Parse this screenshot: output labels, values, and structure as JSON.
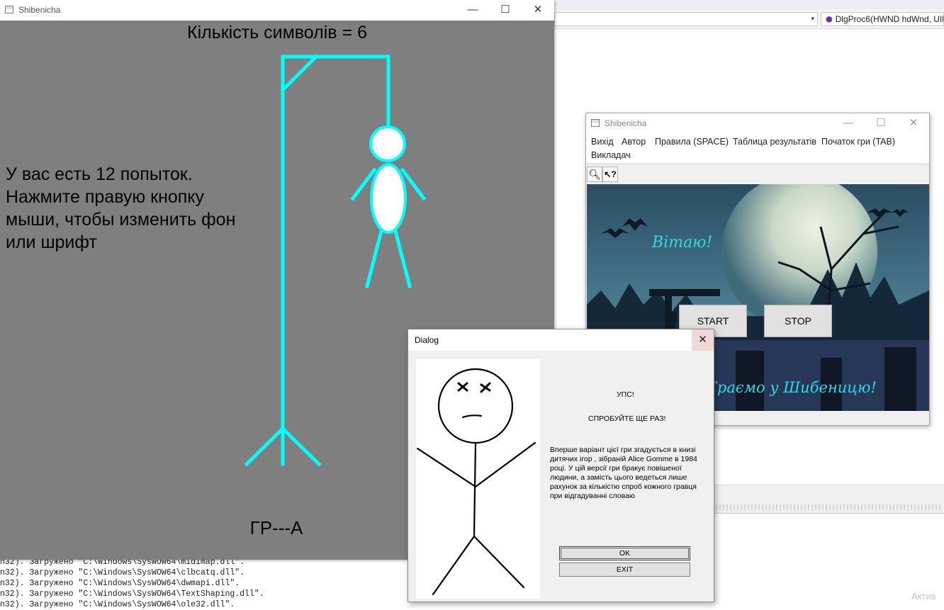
{
  "ide": {
    "function_combo": "DlgProc6(HWND hdWnd, UIN",
    "output_lines": [
      "n32). Загружено \"C:\\Windows\\SysWOW64\\midimap.dll\".",
      "n32). Загружено \"C:\\Windows\\SysWOW64\\clbcatq.dll\".",
      "n32). Загружено \"C:\\Windows\\SysWOW64\\dwmapi.dll\".",
      "n32). Загружено \"C:\\Windows\\SysWOW64\\TextShaping.dll\".",
      "n32). Загружено \"C:\\Windows\\SysWOW64\\ole32.dll\"."
    ],
    "watermark": "Актив"
  },
  "game_window": {
    "title": "Shibenicha",
    "symbol_count": "Кількість символів = 6",
    "hint_lines": [
      "У вас есть 12 попыток.",
      "Нажмите правую кнопку",
      "мыши, чтобы изменить фон",
      "или шрифт"
    ],
    "word": "ГР---А"
  },
  "menu_window": {
    "title": "Shibenicha",
    "menu": [
      "Вихід",
      "Автор",
      "Правила  (SPACE)",
      "Таблица результатів",
      "Початок гри  (TAB)",
      "Викладач"
    ],
    "greeting": "Вітаю!",
    "start_label": "START",
    "stop_label": "STOP",
    "play_text": "Граємо у Шибеницю!"
  },
  "dialog": {
    "title": "Dialog",
    "ups": "УПС!",
    "try_again": "СПРОБУЙТЕ ЩЕ РАЗ!",
    "description": "Вперше варіант цієї гри згадується в книзі дитячих ігор , зібраній Alice Gomme в 1984 році. У цій версії гри бракує повішеної людини, а замість цього ведеться лише рахунок за кількістю спроб кожного гравця при відгадуванні словаю",
    "ok_label": "OK",
    "exit_label": "EXIT"
  },
  "colors": {
    "gallows": "#00ffff",
    "game_bg": "#7f7f7f",
    "accent_text": "#2fd8e8"
  },
  "icons": {
    "minimize": "minimize-icon",
    "maximize": "maximize-icon",
    "close": "close-icon",
    "search": "magnifier-icon",
    "help": "context-help-icon"
  }
}
